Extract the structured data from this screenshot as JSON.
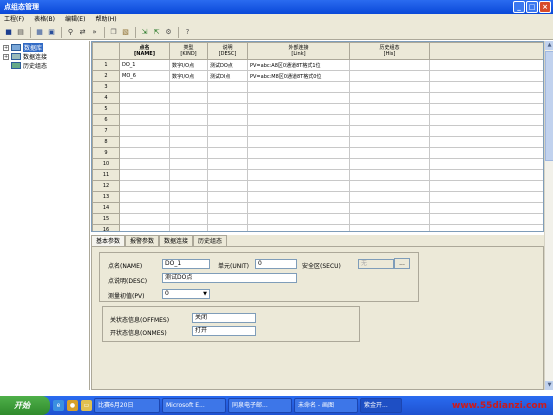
{
  "window": {
    "title": "点组态管理"
  },
  "menu": [
    "工程(F)",
    "表格(B)",
    "编辑(E)",
    "帮助(H)"
  ],
  "toolbar_icons": [
    "save-icon",
    "print-icon",
    "grid-icon",
    "preview-icon",
    "find-icon",
    "replace-icon",
    "find-next-icon",
    "copy-icon",
    "paste-icon",
    "import-icon",
    "export-icon",
    "settings-icon",
    "help-icon"
  ],
  "tree": {
    "items": [
      {
        "label": "数据库",
        "expander": "+",
        "selected": true
      },
      {
        "label": "数据连接",
        "expander": "+",
        "selected": false
      },
      {
        "label": "历史组态",
        "expander": "",
        "selected": false
      }
    ]
  },
  "grid": {
    "columns": [
      {
        "title": "点名",
        "sub": "[NAME]"
      },
      {
        "title": "类型",
        "sub": "[KIND]"
      },
      {
        "title": "说明",
        "sub": "[DESC]"
      },
      {
        "title": "外部连接",
        "sub": "[Link]"
      },
      {
        "title": "历史组态",
        "sub": "[His]"
      },
      {
        "title": "",
        "sub": ""
      }
    ],
    "rows": [
      {
        "n": "1",
        "cells": [
          "DO_1",
          "数字I/O点",
          "测试DO点",
          "PV=abc:A8区0通道8T格式1位",
          "",
          ""
        ]
      },
      {
        "n": "2",
        "cells": [
          "MO_6",
          "数字I/O点",
          "测试DI点",
          "PV=abc:M8区0通道8T格式0位",
          "",
          ""
        ]
      },
      {
        "n": "3",
        "cells": [
          "",
          "",
          "",
          "",
          "",
          ""
        ]
      },
      {
        "n": "4",
        "cells": [
          "",
          "",
          "",
          "",
          "",
          ""
        ]
      },
      {
        "n": "5",
        "cells": [
          "",
          "",
          "",
          "",
          "",
          ""
        ]
      },
      {
        "n": "6",
        "cells": [
          "",
          "",
          "",
          "",
          "",
          ""
        ]
      },
      {
        "n": "7",
        "cells": [
          "",
          "",
          "",
          "",
          "",
          ""
        ]
      },
      {
        "n": "8",
        "cells": [
          "",
          "",
          "",
          "",
          "",
          ""
        ]
      },
      {
        "n": "9",
        "cells": [
          "",
          "",
          "",
          "",
          "",
          ""
        ]
      },
      {
        "n": "10",
        "cells": [
          "",
          "",
          "",
          "",
          "",
          ""
        ]
      },
      {
        "n": "11",
        "cells": [
          "",
          "",
          "",
          "",
          "",
          ""
        ]
      },
      {
        "n": "12",
        "cells": [
          "",
          "",
          "",
          "",
          "",
          ""
        ]
      },
      {
        "n": "13",
        "cells": [
          "",
          "",
          "",
          "",
          "",
          ""
        ]
      },
      {
        "n": "14",
        "cells": [
          "",
          "",
          "",
          "",
          "",
          ""
        ]
      },
      {
        "n": "15",
        "cells": [
          "",
          "",
          "",
          "",
          "",
          ""
        ]
      },
      {
        "n": "16",
        "cells": [
          "",
          "",
          "",
          "",
          "",
          ""
        ]
      }
    ]
  },
  "tabs": [
    "基本参数",
    "报警参数",
    "数据连接",
    "历史组态"
  ],
  "form": {
    "name_label": "点名(NAME)",
    "name_value": "DO_1",
    "unit_label": "单元(UNIT)",
    "unit_value": "0",
    "secu_label": "安全区(SECU)",
    "secu_value": "无",
    "browse_label": "...",
    "desc_label": "点说明(DESC)",
    "desc_value": "测试DO点",
    "pv_label": "测量初值(PV)",
    "pv_value": "0",
    "offmes_label": "关状态信息(OFFMES)",
    "offmes_value": "关闭",
    "onmes_label": "开状态信息(ONMES)",
    "onmes_value": "打开"
  },
  "taskbar": {
    "start_label": "开始",
    "tasks": [
      "比赛6月20日",
      "Microsoft E...",
      "同泉电子邮...",
      "未命名 - 画图",
      "紫金开..."
    ]
  },
  "watermark": "www.55dianzi.com"
}
